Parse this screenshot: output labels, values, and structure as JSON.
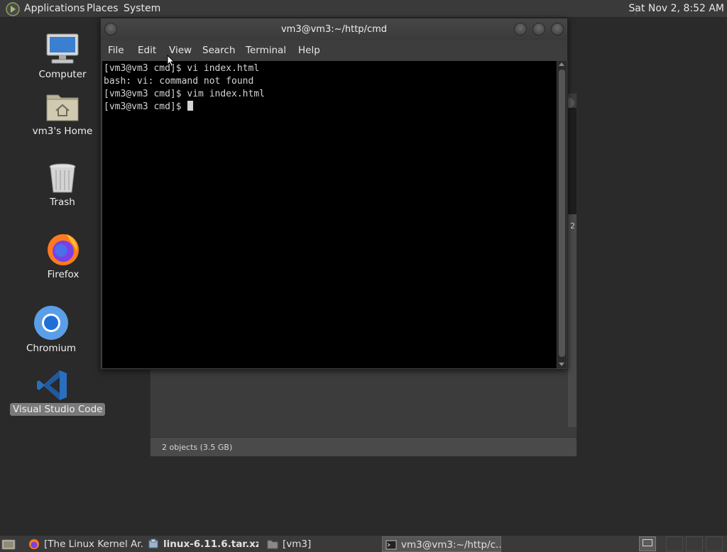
{
  "top_panel": {
    "menus": [
      "Applications",
      "Places",
      "System"
    ],
    "clock": "Sat Nov  2,  8:52 AM"
  },
  "desktop": {
    "icons": [
      {
        "label": "Computer",
        "icon": "computer-icon"
      },
      {
        "label": "vm3's Home",
        "icon": "home-folder-icon"
      },
      {
        "label": "Trash",
        "icon": "trash-icon"
      },
      {
        "label": "Firefox",
        "icon": "firefox-icon"
      },
      {
        "label": "Chromium",
        "icon": "chromium-icon"
      },
      {
        "label": "Visual Studio Code",
        "icon": "vscode-icon",
        "selected": true
      }
    ]
  },
  "file_manager": {
    "status": "2 objects (3.5 GB)",
    "partial_label": "2"
  },
  "terminal": {
    "title": "vm3@vm3:~/http/cmd",
    "menus": [
      "File",
      "Edit",
      "View",
      "Search",
      "Terminal",
      "Help"
    ],
    "lines": [
      "[vm3@vm3 cmd]$ vi index.html",
      "bash: vi: command not found",
      "[vm3@vm3 cmd]$ vim index.html",
      "[vm3@vm3 cmd]$ "
    ]
  },
  "taskbar": {
    "tasks": [
      {
        "label": "[The Linux Kernel Ar...",
        "icon": "firefox-icon",
        "bold": false,
        "active": false
      },
      {
        "label": "linux-6.11.6.tar.xz",
        "icon": "archive-icon",
        "bold": true,
        "active": false
      },
      {
        "label": "[vm3]",
        "icon": "folder-icon",
        "bold": false,
        "active": false
      },
      {
        "label": "vm3@vm3:~/http/c...",
        "icon": "terminal-icon",
        "bold": false,
        "active": true
      }
    ]
  },
  "colors": {
    "desktop_bg": "#2a2a2a",
    "panel_bg": "#3a3a3a",
    "terminal_bg": "#000000",
    "terminal_fg": "#d4d4d4",
    "selection": "#7a7a7a"
  }
}
